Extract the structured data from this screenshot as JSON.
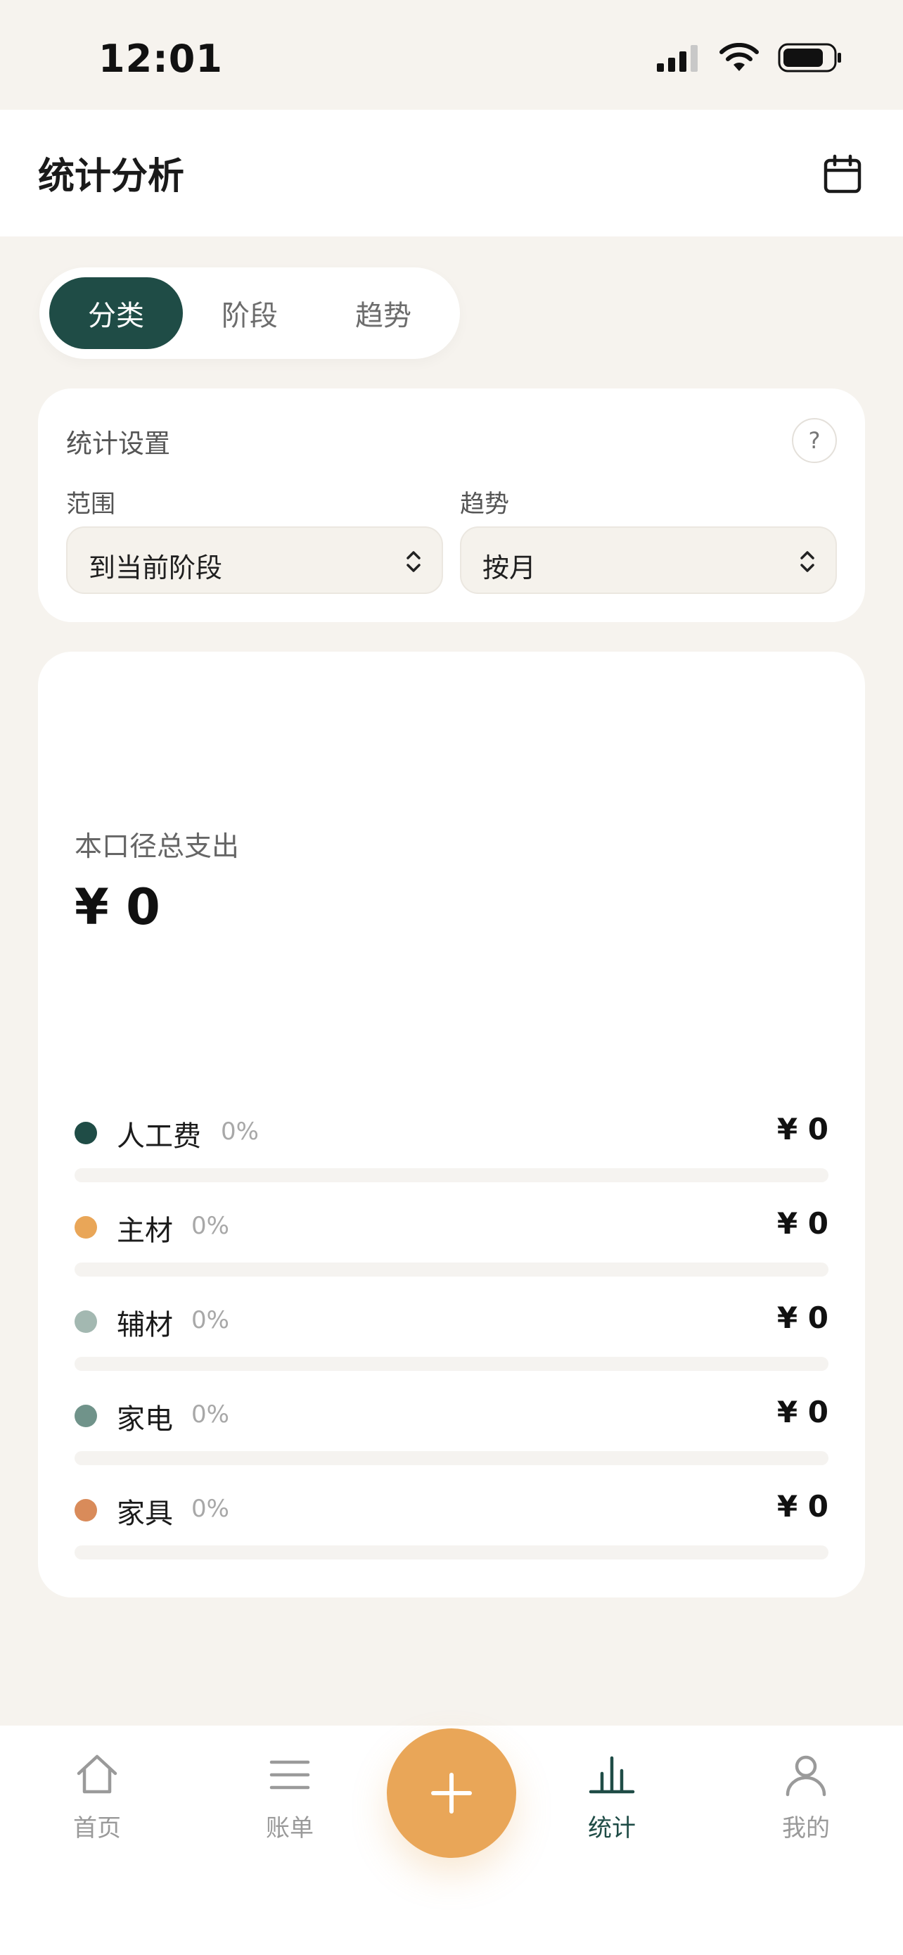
{
  "status_bar": {
    "time": "12:01"
  },
  "header": {
    "title": "统计分析"
  },
  "tabs": [
    {
      "label": "分类",
      "active": true
    },
    {
      "label": "阶段",
      "active": false
    },
    {
      "label": "趋势",
      "active": false
    }
  ],
  "settings": {
    "title": "统计设置",
    "help": "?",
    "range": {
      "label": "范围",
      "value": "到当前阶段"
    },
    "trend": {
      "label": "趋势",
      "value": "按月"
    }
  },
  "summary": {
    "label": "本口径总支出",
    "value": "¥ 0"
  },
  "categories": [
    {
      "name": "人工费",
      "percent": "0%",
      "percent_value": 0,
      "amount": "¥ 0",
      "color": "#1f4c46"
    },
    {
      "name": "主材",
      "percent": "0%",
      "percent_value": 0,
      "amount": "¥ 0",
      "color": "#e9a658"
    },
    {
      "name": "辅材",
      "percent": "0%",
      "percent_value": 0,
      "amount": "¥ 0",
      "color": "#a3b8b1"
    },
    {
      "name": "家电",
      "percent": "0%",
      "percent_value": 0,
      "amount": "¥ 0",
      "color": "#70938a"
    },
    {
      "name": "家具",
      "percent": "0%",
      "percent_value": 0,
      "amount": "¥ 0",
      "color": "#d98b5a"
    }
  ],
  "nav": {
    "home": "首页",
    "bills": "账单",
    "stats": "统计",
    "mine": "我的"
  },
  "colors": {
    "primary": "#1f4c46",
    "accent": "#e9a658",
    "background": "#f6f3ee"
  }
}
